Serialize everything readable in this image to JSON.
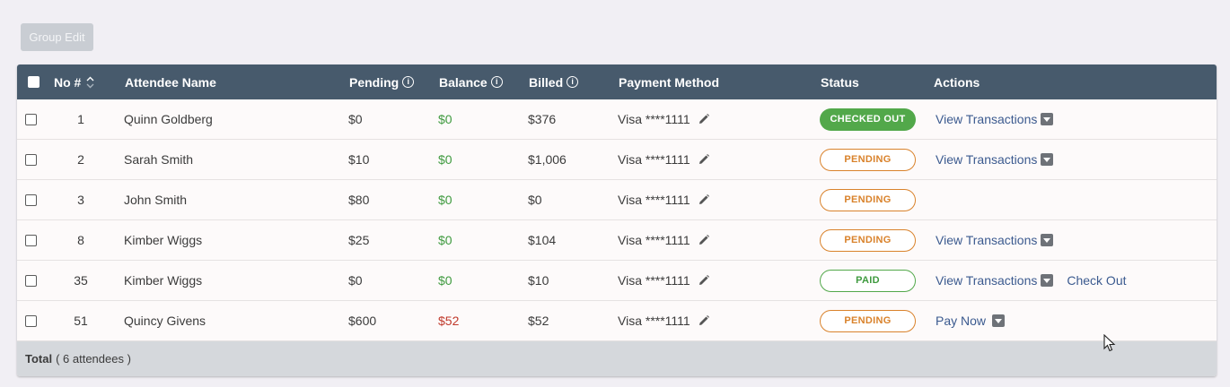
{
  "toolbar": {
    "group_edit_label": "Group Edit"
  },
  "columns": {
    "no": "No #",
    "name": "Attendee Name",
    "pending": "Pending",
    "balance": "Balance",
    "billed": "Billed",
    "payment": "Payment Method",
    "status": "Status",
    "actions": "Actions"
  },
  "rows": [
    {
      "no": "1",
      "name": "Quinn Goldberg",
      "pending": "$0",
      "balance": "$0",
      "billed": "$376",
      "payment": "Visa ****1111",
      "status": "CHECKED OUT",
      "action1": "View Transactions",
      "action2": ""
    },
    {
      "no": "2",
      "name": "Sarah Smith",
      "pending": "$10",
      "balance": "$0",
      "billed": "$1,006",
      "payment": "Visa ****1111",
      "status": "PENDING",
      "action1": "View Transactions",
      "action2": ""
    },
    {
      "no": "3",
      "name": "John Smith",
      "pending": "$80",
      "balance": "$0",
      "billed": "$0",
      "payment": "Visa ****1111",
      "status": "PENDING",
      "action1": "",
      "action2": ""
    },
    {
      "no": "8",
      "name": "Kimber Wiggs",
      "pending": "$25",
      "balance": "$0",
      "billed": "$104",
      "payment": "Visa ****1111",
      "status": "PENDING",
      "action1": "View Transactions",
      "action2": ""
    },
    {
      "no": "35",
      "name": "Kimber Wiggs",
      "pending": "$0",
      "balance": "$0",
      "billed": "$10",
      "payment": "Visa ****1111",
      "status": "PAID",
      "action1": "View Transactions",
      "action2": "Check Out"
    },
    {
      "no": "51",
      "name": "Quincy Givens",
      "pending": "$600",
      "balance": "$52",
      "billed": "$52",
      "payment": "Visa ****1111",
      "status": "PENDING",
      "action1": "Pay Now",
      "action2": ""
    }
  ],
  "footer": {
    "total_label": "Total",
    "count_text": "( 6 attendees )"
  },
  "icons": {
    "info": "info-icon",
    "sort": "sort-icon",
    "edit": "pencil-icon",
    "dropdown": "caret-down-icon"
  },
  "colors": {
    "header_bg": "#475a6c",
    "balance_positive": "#3f9a3f",
    "balance_due": "#c0392b",
    "pending": "#d9822b",
    "paid": "#52a84a",
    "link": "#3b5a8f"
  }
}
